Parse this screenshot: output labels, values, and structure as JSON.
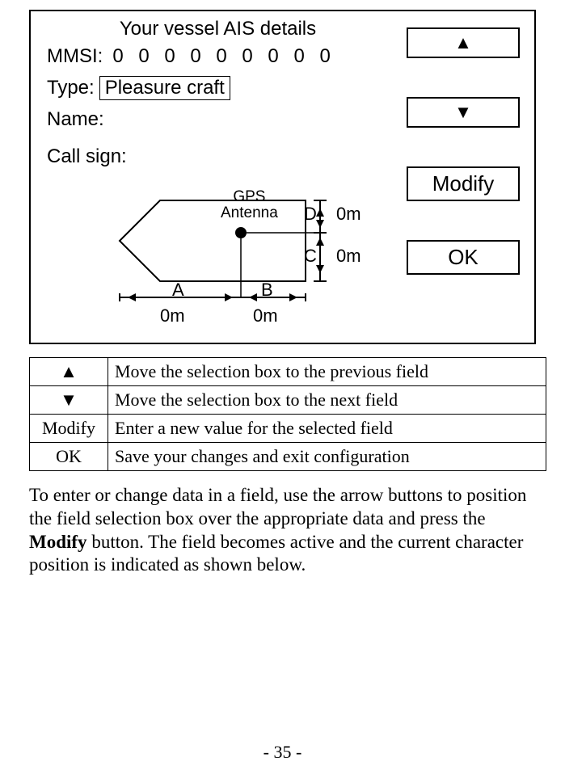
{
  "screen": {
    "title": "Your vessel AIS details",
    "mmsi_label": "MMSI:",
    "mmsi_value": "0 0 0 0 0 0 0 0 0",
    "type_label": "Type:",
    "type_value": "Pleasure craft",
    "name_label": "Name:",
    "callsign_label": "Call sign:"
  },
  "diagram": {
    "gps_label_1": "GPS",
    "gps_label_2": "Antenna",
    "A": "A",
    "B": "B",
    "C": "C",
    "D": "D",
    "value_A": "0m",
    "value_B": "0m",
    "value_C": "0m",
    "value_D": "0m"
  },
  "buttons": {
    "up": "▲",
    "down": "▼",
    "modify": "Modify",
    "ok": "OK"
  },
  "help_table": {
    "rows": [
      {
        "btn": "▲",
        "desc": "Move the selection box to the previous field"
      },
      {
        "btn": "▼",
        "desc": "Move the selection box to the next field"
      },
      {
        "btn": "Modify",
        "desc": "Enter a new value for the selected field"
      },
      {
        "btn": "OK",
        "desc": "Save your changes and exit configuration"
      }
    ]
  },
  "body": {
    "p1a": "To enter or change data in a field, use the arrow buttons to position the field selection box over the appropriate data and press the ",
    "p1b": "Modify",
    "p1c": " button. The field becomes active and the current character position is indicated as shown below."
  },
  "page_number": "- 35 -"
}
